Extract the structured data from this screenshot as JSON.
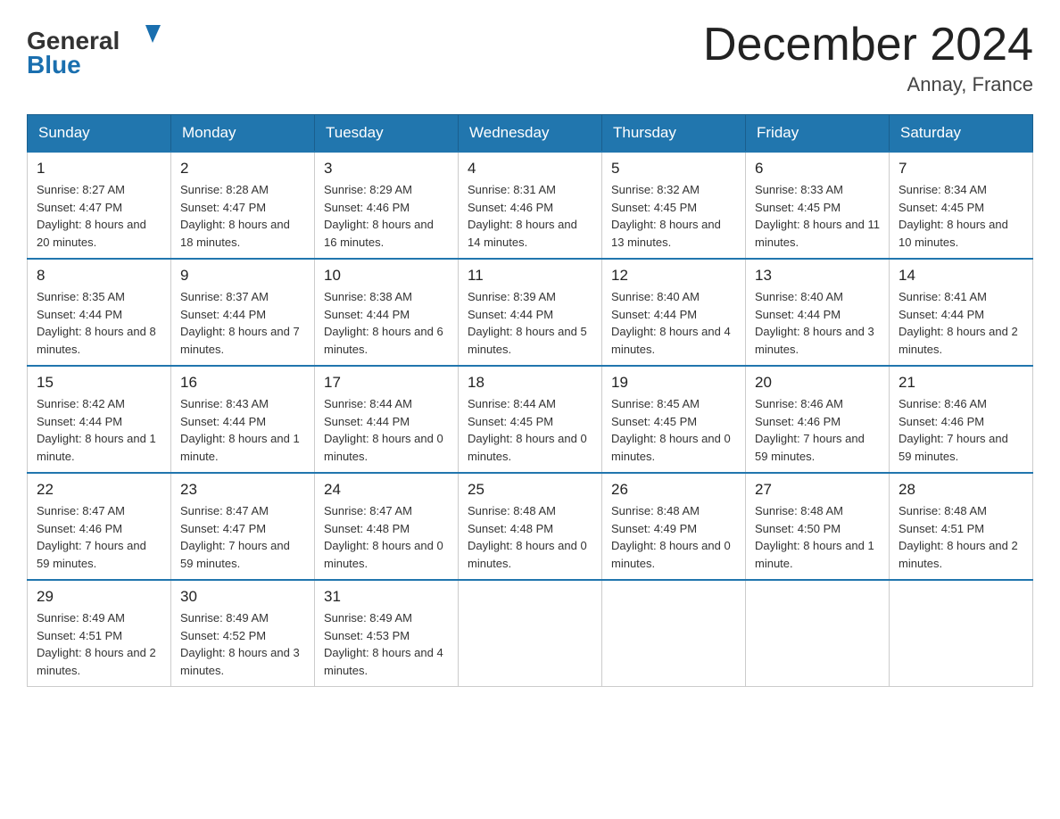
{
  "header": {
    "logo_general": "General",
    "logo_blue": "Blue",
    "month_title": "December 2024",
    "location": "Annay, France"
  },
  "days_of_week": [
    "Sunday",
    "Monday",
    "Tuesday",
    "Wednesday",
    "Thursday",
    "Friday",
    "Saturday"
  ],
  "weeks": [
    [
      {
        "day": "1",
        "sunrise": "Sunrise: 8:27 AM",
        "sunset": "Sunset: 4:47 PM",
        "daylight": "Daylight: 8 hours and 20 minutes."
      },
      {
        "day": "2",
        "sunrise": "Sunrise: 8:28 AM",
        "sunset": "Sunset: 4:47 PM",
        "daylight": "Daylight: 8 hours and 18 minutes."
      },
      {
        "day": "3",
        "sunrise": "Sunrise: 8:29 AM",
        "sunset": "Sunset: 4:46 PM",
        "daylight": "Daylight: 8 hours and 16 minutes."
      },
      {
        "day": "4",
        "sunrise": "Sunrise: 8:31 AM",
        "sunset": "Sunset: 4:46 PM",
        "daylight": "Daylight: 8 hours and 14 minutes."
      },
      {
        "day": "5",
        "sunrise": "Sunrise: 8:32 AM",
        "sunset": "Sunset: 4:45 PM",
        "daylight": "Daylight: 8 hours and 13 minutes."
      },
      {
        "day": "6",
        "sunrise": "Sunrise: 8:33 AM",
        "sunset": "Sunset: 4:45 PM",
        "daylight": "Daylight: 8 hours and 11 minutes."
      },
      {
        "day": "7",
        "sunrise": "Sunrise: 8:34 AM",
        "sunset": "Sunset: 4:45 PM",
        "daylight": "Daylight: 8 hours and 10 minutes."
      }
    ],
    [
      {
        "day": "8",
        "sunrise": "Sunrise: 8:35 AM",
        "sunset": "Sunset: 4:44 PM",
        "daylight": "Daylight: 8 hours and 8 minutes."
      },
      {
        "day": "9",
        "sunrise": "Sunrise: 8:37 AM",
        "sunset": "Sunset: 4:44 PM",
        "daylight": "Daylight: 8 hours and 7 minutes."
      },
      {
        "day": "10",
        "sunrise": "Sunrise: 8:38 AM",
        "sunset": "Sunset: 4:44 PM",
        "daylight": "Daylight: 8 hours and 6 minutes."
      },
      {
        "day": "11",
        "sunrise": "Sunrise: 8:39 AM",
        "sunset": "Sunset: 4:44 PM",
        "daylight": "Daylight: 8 hours and 5 minutes."
      },
      {
        "day": "12",
        "sunrise": "Sunrise: 8:40 AM",
        "sunset": "Sunset: 4:44 PM",
        "daylight": "Daylight: 8 hours and 4 minutes."
      },
      {
        "day": "13",
        "sunrise": "Sunrise: 8:40 AM",
        "sunset": "Sunset: 4:44 PM",
        "daylight": "Daylight: 8 hours and 3 minutes."
      },
      {
        "day": "14",
        "sunrise": "Sunrise: 8:41 AM",
        "sunset": "Sunset: 4:44 PM",
        "daylight": "Daylight: 8 hours and 2 minutes."
      }
    ],
    [
      {
        "day": "15",
        "sunrise": "Sunrise: 8:42 AM",
        "sunset": "Sunset: 4:44 PM",
        "daylight": "Daylight: 8 hours and 1 minute."
      },
      {
        "day": "16",
        "sunrise": "Sunrise: 8:43 AM",
        "sunset": "Sunset: 4:44 PM",
        "daylight": "Daylight: 8 hours and 1 minute."
      },
      {
        "day": "17",
        "sunrise": "Sunrise: 8:44 AM",
        "sunset": "Sunset: 4:44 PM",
        "daylight": "Daylight: 8 hours and 0 minutes."
      },
      {
        "day": "18",
        "sunrise": "Sunrise: 8:44 AM",
        "sunset": "Sunset: 4:45 PM",
        "daylight": "Daylight: 8 hours and 0 minutes."
      },
      {
        "day": "19",
        "sunrise": "Sunrise: 8:45 AM",
        "sunset": "Sunset: 4:45 PM",
        "daylight": "Daylight: 8 hours and 0 minutes."
      },
      {
        "day": "20",
        "sunrise": "Sunrise: 8:46 AM",
        "sunset": "Sunset: 4:46 PM",
        "daylight": "Daylight: 7 hours and 59 minutes."
      },
      {
        "day": "21",
        "sunrise": "Sunrise: 8:46 AM",
        "sunset": "Sunset: 4:46 PM",
        "daylight": "Daylight: 7 hours and 59 minutes."
      }
    ],
    [
      {
        "day": "22",
        "sunrise": "Sunrise: 8:47 AM",
        "sunset": "Sunset: 4:46 PM",
        "daylight": "Daylight: 7 hours and 59 minutes."
      },
      {
        "day": "23",
        "sunrise": "Sunrise: 8:47 AM",
        "sunset": "Sunset: 4:47 PM",
        "daylight": "Daylight: 7 hours and 59 minutes."
      },
      {
        "day": "24",
        "sunrise": "Sunrise: 8:47 AM",
        "sunset": "Sunset: 4:48 PM",
        "daylight": "Daylight: 8 hours and 0 minutes."
      },
      {
        "day": "25",
        "sunrise": "Sunrise: 8:48 AM",
        "sunset": "Sunset: 4:48 PM",
        "daylight": "Daylight: 8 hours and 0 minutes."
      },
      {
        "day": "26",
        "sunrise": "Sunrise: 8:48 AM",
        "sunset": "Sunset: 4:49 PM",
        "daylight": "Daylight: 8 hours and 0 minutes."
      },
      {
        "day": "27",
        "sunrise": "Sunrise: 8:48 AM",
        "sunset": "Sunset: 4:50 PM",
        "daylight": "Daylight: 8 hours and 1 minute."
      },
      {
        "day": "28",
        "sunrise": "Sunrise: 8:48 AM",
        "sunset": "Sunset: 4:51 PM",
        "daylight": "Daylight: 8 hours and 2 minutes."
      }
    ],
    [
      {
        "day": "29",
        "sunrise": "Sunrise: 8:49 AM",
        "sunset": "Sunset: 4:51 PM",
        "daylight": "Daylight: 8 hours and 2 minutes."
      },
      {
        "day": "30",
        "sunrise": "Sunrise: 8:49 AM",
        "sunset": "Sunset: 4:52 PM",
        "daylight": "Daylight: 8 hours and 3 minutes."
      },
      {
        "day": "31",
        "sunrise": "Sunrise: 8:49 AM",
        "sunset": "Sunset: 4:53 PM",
        "daylight": "Daylight: 8 hours and 4 minutes."
      },
      null,
      null,
      null,
      null
    ]
  ]
}
